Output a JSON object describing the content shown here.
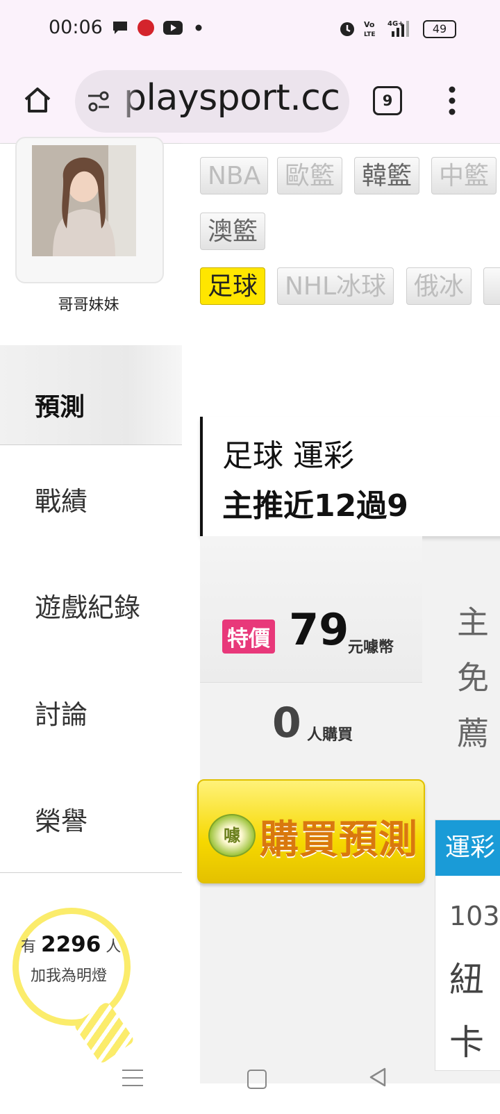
{
  "status_bar": {
    "time": "00:06",
    "battery": "49",
    "network": "4G+"
  },
  "browser": {
    "url": "playsport.cc",
    "tab_count": "9"
  },
  "profile": {
    "name": "哥哥妹妹"
  },
  "sidebar": {
    "active": "預測",
    "items": [
      {
        "label": "戰績"
      },
      {
        "label": "遊戲紀錄"
      },
      {
        "label": "討論"
      },
      {
        "label": "榮譽"
      }
    ],
    "fans": {
      "prefix": "有",
      "count": "2296",
      "suffix": "人",
      "line2": "加我為明燈"
    }
  },
  "category_tags": [
    {
      "label": "NBA"
    },
    {
      "label": "歐籃"
    },
    {
      "label": "韓籃"
    },
    {
      "label": "中籃"
    },
    {
      "label": "澳籃"
    },
    {
      "label": "足球"
    },
    {
      "label": "NHL冰球"
    },
    {
      "label": "俄冰"
    }
  ],
  "prediction": {
    "title_line1": "足球 運彩",
    "title_line2": "主推近12過9",
    "sale_badge": "特價",
    "price": "79",
    "price_unit": "元噱幣",
    "buyers": "0",
    "buyers_unit": "人購買",
    "side_chars": [
      "主",
      "免",
      "薦"
    ],
    "buy_button": "購買預測",
    "buy_icon_char": "噱"
  },
  "odds_panel": {
    "header": "運彩",
    "number": "103",
    "team1": "紐",
    "team2": "卡"
  },
  "colors": {
    "accent_yellow": "#ffe600",
    "sale_pink": "#e8387a",
    "blue_header": "#1a9bd7",
    "button_orange": "#d9780e"
  }
}
